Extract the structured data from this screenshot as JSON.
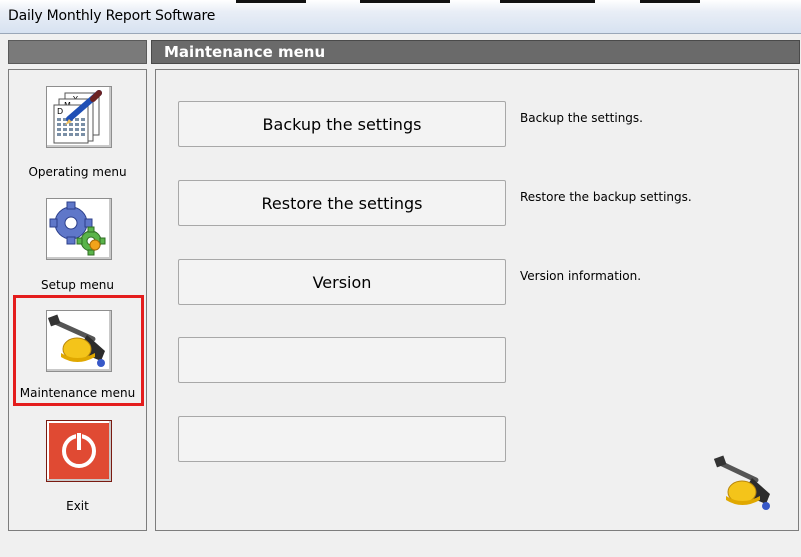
{
  "window": {
    "title": "Daily Monthly Report Software"
  },
  "header": {
    "title": "Maintenance menu"
  },
  "sidebar": {
    "items": [
      {
        "label": "Operating menu",
        "icon": "calendar-pen-icon"
      },
      {
        "label": "Setup menu",
        "icon": "gears-icon"
      },
      {
        "label": "Maintenance menu",
        "icon": "hardhat-hammer-icon",
        "selected": true
      },
      {
        "label": "Exit",
        "icon": "power-icon"
      }
    ]
  },
  "main": {
    "buttons": [
      {
        "label": "Backup the settings",
        "description": "Backup the settings."
      },
      {
        "label": "Restore the settings",
        "description": "Restore the backup settings."
      },
      {
        "label": "Version",
        "description": "Version information."
      },
      {
        "label": "",
        "description": ""
      },
      {
        "label": "",
        "description": ""
      }
    ]
  },
  "colors": {
    "header_bg": "#6a6a6a",
    "selection_outline": "#e41d1d",
    "exit_red": "#d9402a"
  }
}
